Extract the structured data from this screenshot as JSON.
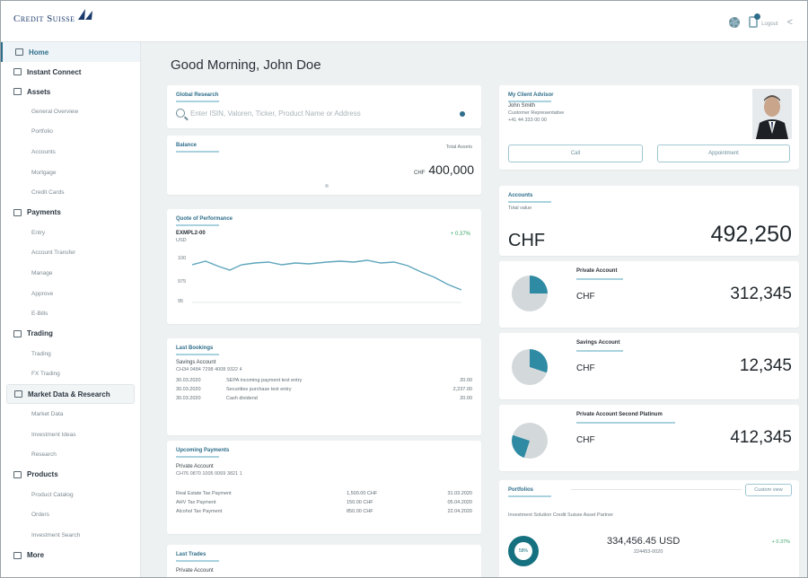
{
  "brand": {
    "name": "Credit Suisse"
  },
  "topbar": {
    "logout_label": "Logout"
  },
  "sidebar": {
    "items": [
      {
        "label": "Home",
        "type": "active"
      },
      {
        "label": "Instant Connect",
        "type": "section"
      },
      {
        "label": "Assets",
        "type": "section"
      },
      {
        "label": "General Overview",
        "type": "sub"
      },
      {
        "label": "Portfolio",
        "type": "sub"
      },
      {
        "label": "Accounts",
        "type": "sub"
      },
      {
        "label": "Mortgage",
        "type": "sub"
      },
      {
        "label": "Credit Cards",
        "type": "sub"
      },
      {
        "label": "Payments",
        "type": "section"
      },
      {
        "label": "Entry",
        "type": "sub"
      },
      {
        "label": "Account Transfer",
        "type": "sub"
      },
      {
        "label": "Manage",
        "type": "sub"
      },
      {
        "label": "Approve",
        "type": "sub"
      },
      {
        "label": "E-Bills",
        "type": "sub"
      },
      {
        "label": "Trading",
        "type": "section"
      },
      {
        "label": "Trading",
        "type": "sub"
      },
      {
        "label": "FX Trading",
        "type": "sub"
      },
      {
        "label": "Market Data & Research",
        "type": "section-highlight"
      },
      {
        "label": "Market Data",
        "type": "sub"
      },
      {
        "label": "Investment Ideas",
        "type": "sub"
      },
      {
        "label": "Research",
        "type": "sub"
      },
      {
        "label": "Products",
        "type": "section"
      },
      {
        "label": "Product Catalog",
        "type": "sub"
      },
      {
        "label": "Orders",
        "type": "sub"
      },
      {
        "label": "Investment Search",
        "type": "sub"
      },
      {
        "label": "More",
        "type": "section"
      }
    ]
  },
  "main": {
    "greeting": "Good Morning, John Doe",
    "quick_search": {
      "title": "Global Research",
      "placeholder": "Enter ISIN, Valoren, Ticker, Product Name or Address"
    },
    "balance": {
      "title": "Balance",
      "link": "Total Assets",
      "currency": "CHF",
      "amount": "400,000"
    },
    "performance": {
      "title": "Quote of Performance",
      "instrument": "EXMPL2-00",
      "unit": "USD",
      "change": "+ 0.37%",
      "y_labels": [
        "100",
        "975",
        "95"
      ]
    },
    "last_bookings": {
      "title": "Last Bookings",
      "account_name": "Savings Account",
      "iban": "CH34 0484 7298 4008 9322 4",
      "rows": [
        {
          "date": "30.03.2020",
          "text": "SEPA incoming payment text entry",
          "amount": "20.00"
        },
        {
          "date": "30.03.2020",
          "text": "Securities purchase text entry",
          "amount": "2,237.00"
        },
        {
          "date": "30.03.2020",
          "text": "Cash dividend",
          "amount": "20.00"
        }
      ]
    },
    "upcoming_payments": {
      "title": "Upcoming Payments",
      "account_name": "Private Account",
      "iban": "CH76 0870 1005 0069 3821 1",
      "rows": [
        {
          "text": "Real Estate Tax Payment",
          "amount": "1,500.00 CHF",
          "date": "31.03.2020"
        },
        {
          "text": "AHV Tax Payment",
          "amount": "150.00 CHF",
          "date": "05.04.2020"
        },
        {
          "text": "Alcohol Tax Payment",
          "amount": "850.00 CHF",
          "date": "22.04.2020"
        }
      ]
    },
    "last_trades": {
      "title": "Last Trades",
      "account_name": "Private Account"
    },
    "relationship_manager": {
      "title": "My Client Advisor",
      "name": "John Smith",
      "role": "Customer Representative",
      "phone": "+41 44 333 00 00",
      "call_label": "Call",
      "appointment_label": "Appointment"
    },
    "accounts": {
      "title": "Accounts",
      "subtitle": "Total value",
      "currency": "CHF",
      "total": "492,250",
      "items": [
        {
          "name": "Private Account",
          "currency": "CHF",
          "amount": "312,345"
        },
        {
          "name": "Savings Account",
          "currency": "CHF",
          "amount": "12,345"
        },
        {
          "name": "Private Account Second Platinum",
          "currency": "CHF",
          "amount": "412,345"
        }
      ]
    },
    "portfolios": {
      "title": "Portfolios",
      "link": "Custom view",
      "portfolio_name": "Investment Solution Credit Suisse Asset Partner",
      "value": "334,456.45 USD",
      "sub_value": "224453-0020",
      "change": "+ 0.37%",
      "donut_label": "58%"
    }
  },
  "colors": {
    "accent": "#2f6e8a",
    "accent_light": "#a9d2de",
    "positive": "#3aa56a",
    "brand_blue": "#1b3a6b"
  }
}
